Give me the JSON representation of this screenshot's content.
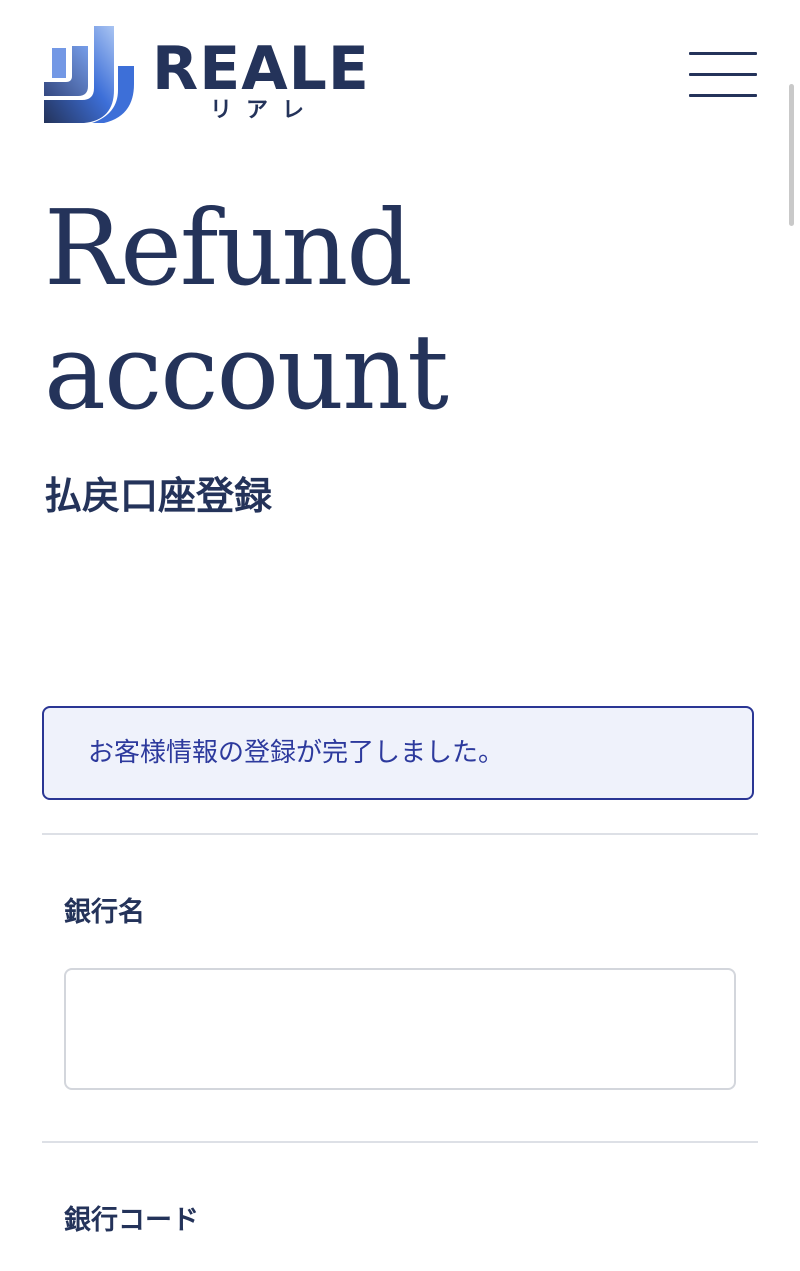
{
  "header": {
    "logo": {
      "wordmark": "REALE",
      "kana": "リアレ"
    },
    "menu_label": "menu",
    "colors": {
      "brand_navy": "#24335a",
      "brand_blue": "#3d6fd8"
    }
  },
  "page": {
    "title_line1": "Refund",
    "title_line2": "account",
    "subtitle": "払戻口座登録"
  },
  "notice": {
    "message": "お客様情報の登録が完了しました。",
    "colors": {
      "border": "#2a3694",
      "background": "#eff2fb",
      "text": "#2d3a9d"
    }
  },
  "form": {
    "bank_name": {
      "label": "銀行名",
      "value": ""
    },
    "bank_code": {
      "label": "銀行コード"
    }
  }
}
